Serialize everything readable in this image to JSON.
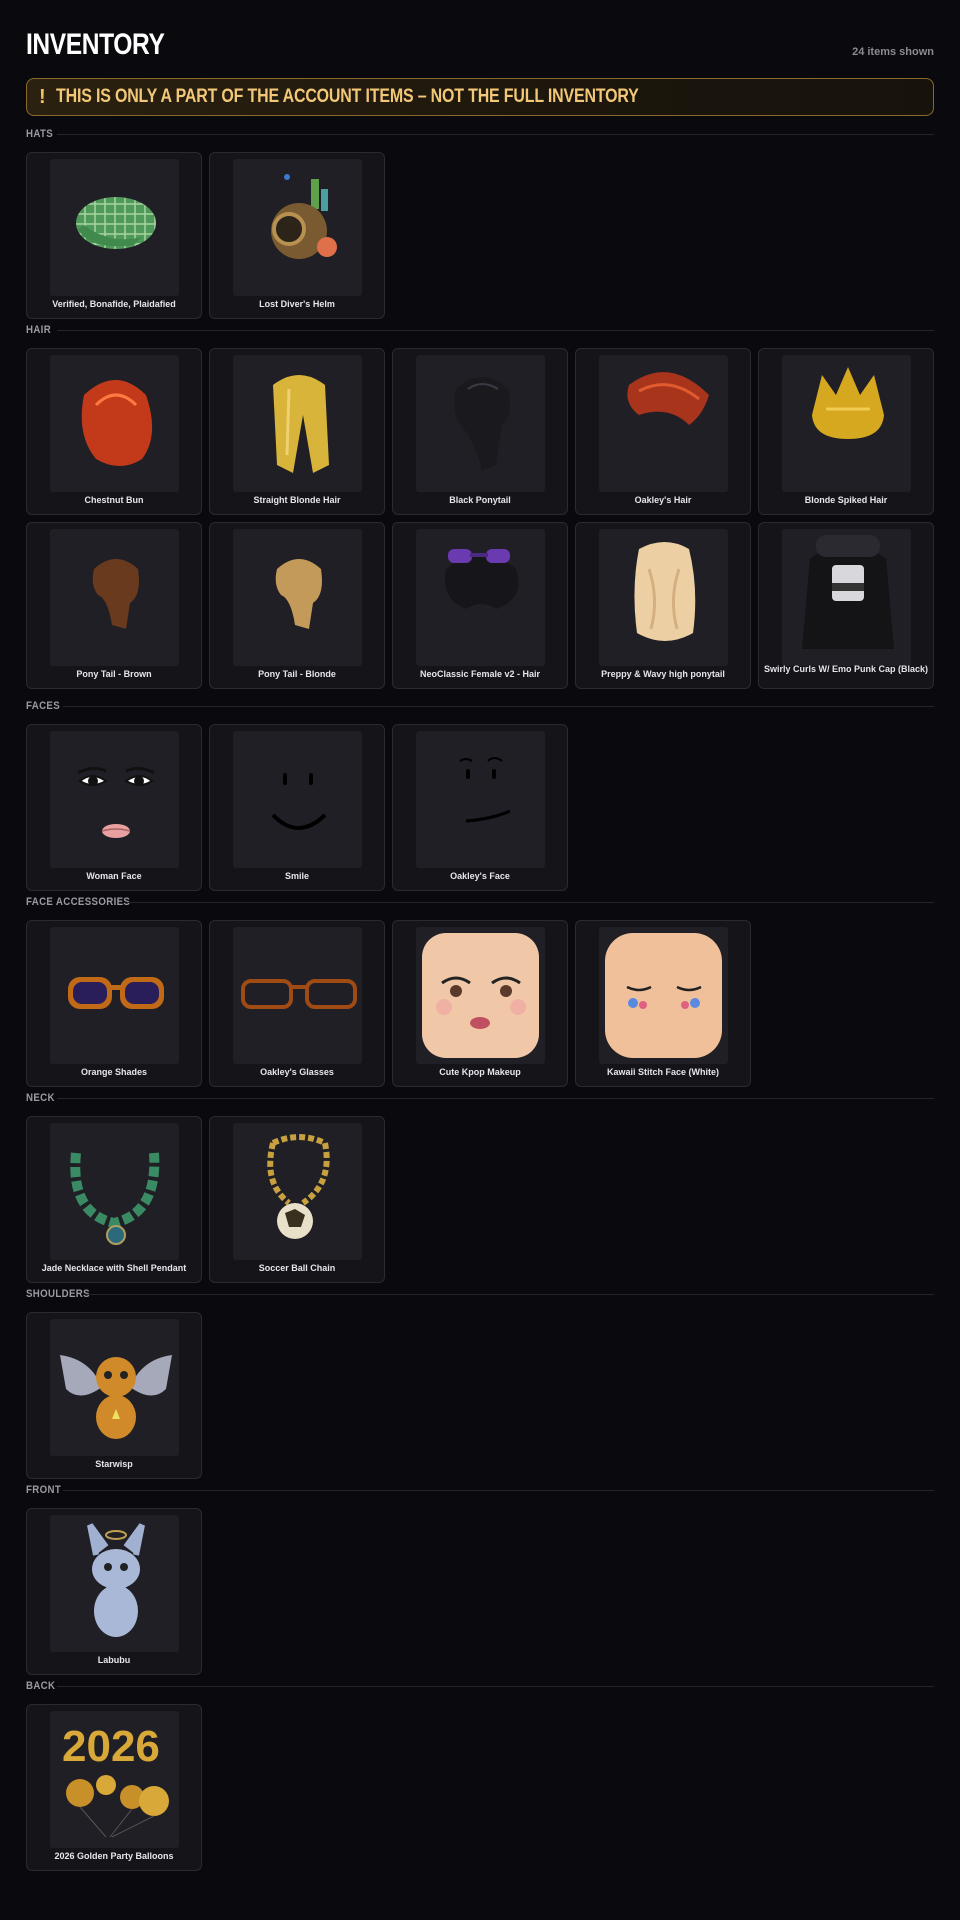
{
  "header": {
    "title": "INVENTORY",
    "count": "24 items shown"
  },
  "warning": {
    "icon": "exclamation-icon",
    "icon_glyph": "!",
    "text": "THIS IS ONLY A PART OF THE ACCOUNT ITEMS – NOT THE FULL INVENTORY"
  },
  "sections": [
    {
      "title": "HATS",
      "items": [
        {
          "name": "Verified, Bonafide, Plaidafied",
          "icon": "plaid-cap-icon"
        },
        {
          "name": "Lost Diver's Helm",
          "icon": "diver-helm-icon"
        }
      ]
    },
    {
      "title": "HAIR",
      "items": [
        {
          "name": "Chestnut Bun",
          "icon": "chestnut-bun-icon"
        },
        {
          "name": "Straight Blonde Hair",
          "icon": "straight-blonde-hair-icon"
        },
        {
          "name": "Black Ponytail",
          "icon": "black-ponytail-icon"
        },
        {
          "name": "Oakley's Hair",
          "icon": "oakley-hair-icon"
        },
        {
          "name": "Blonde Spiked Hair",
          "icon": "blonde-spiked-hair-icon"
        },
        {
          "name": "Pony Tail - Brown",
          "icon": "brown-ponytail-icon"
        },
        {
          "name": "Pony Tail - Blonde",
          "icon": "blonde-ponytail-icon"
        },
        {
          "name": "NeoClassic Female v2 - Hair",
          "icon": "neoclassic-hair-icon"
        },
        {
          "name": "Preppy & Wavy high ponytail",
          "icon": "wavy-ponytail-icon"
        },
        {
          "name": "Swirly Curls W/ Emo Punk Cap (Black)",
          "icon": "emo-curls-icon"
        }
      ]
    },
    {
      "title": "FACES",
      "items": [
        {
          "name": "Woman Face",
          "icon": "woman-face-icon"
        },
        {
          "name": "Smile",
          "icon": "smile-face-icon"
        },
        {
          "name": "Oakley's Face",
          "icon": "oakley-face-icon"
        }
      ]
    },
    {
      "title": "FACE ACCESSORIES",
      "items": [
        {
          "name": "Orange Shades",
          "icon": "orange-shades-icon"
        },
        {
          "name": "Oakley's Glasses",
          "icon": "oakley-glasses-icon"
        },
        {
          "name": "Cute Kpop Makeup",
          "icon": "kpop-makeup-icon"
        },
        {
          "name": "Kawaii Stitch Face (White)",
          "icon": "kawaii-face-icon"
        }
      ]
    },
    {
      "title": "NECK",
      "items": [
        {
          "name": "Jade Necklace with Shell Pendant",
          "icon": "jade-necklace-icon"
        },
        {
          "name": "Soccer Ball Chain",
          "icon": "soccer-chain-icon"
        }
      ]
    },
    {
      "title": "SHOULDERS",
      "items": [
        {
          "name": "Starwisp",
          "icon": "starwisp-icon"
        }
      ]
    },
    {
      "title": "FRONT",
      "items": [
        {
          "name": "Labubu",
          "icon": "labubu-icon"
        }
      ]
    },
    {
      "title": "BACK",
      "items": [
        {
          "name": "2026 Golden Party Balloons",
          "icon": "golden-balloons-icon"
        }
      ]
    }
  ]
}
